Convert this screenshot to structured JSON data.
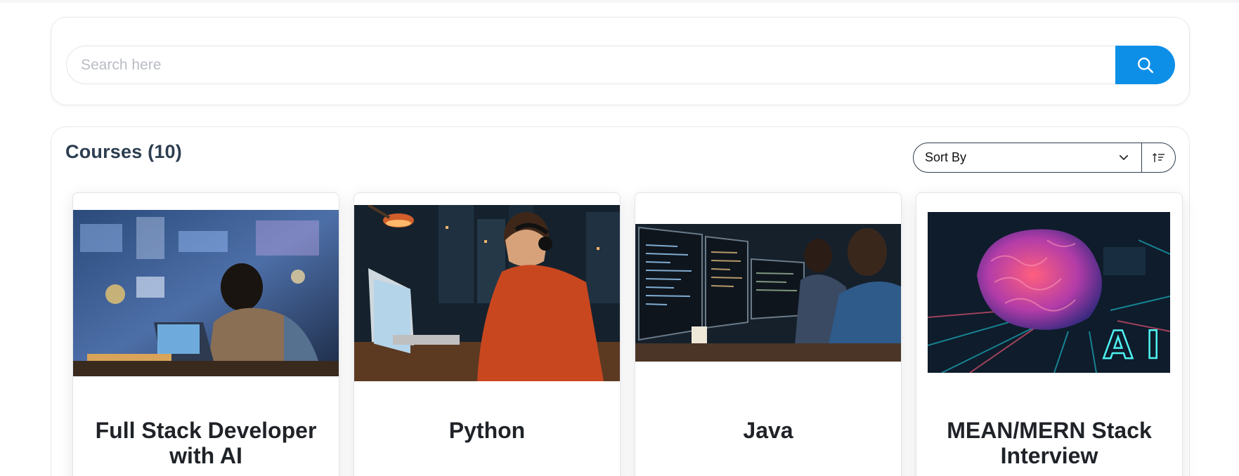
{
  "search": {
    "placeholder": "Search here",
    "button_icon": "search-icon",
    "button_color": "#0d8fe8"
  },
  "courses": {
    "title": "Courses (10)",
    "sort": {
      "selected": "Sort By",
      "icon": "chevron-down-icon",
      "order_icon": "sort-order-icon"
    },
    "items": [
      {
        "title": "Full Stack Developer with AI",
        "image": "student-laptop-neon-city-image"
      },
      {
        "title": "Python",
        "image": "coder-headphones-night-image"
      },
      {
        "title": "Java",
        "image": "developers-monitors-code-image"
      },
      {
        "title": "MEAN/MERN Stack Interview",
        "image": "ai-brain-circuit-image",
        "image_text": "AI"
      }
    ]
  }
}
